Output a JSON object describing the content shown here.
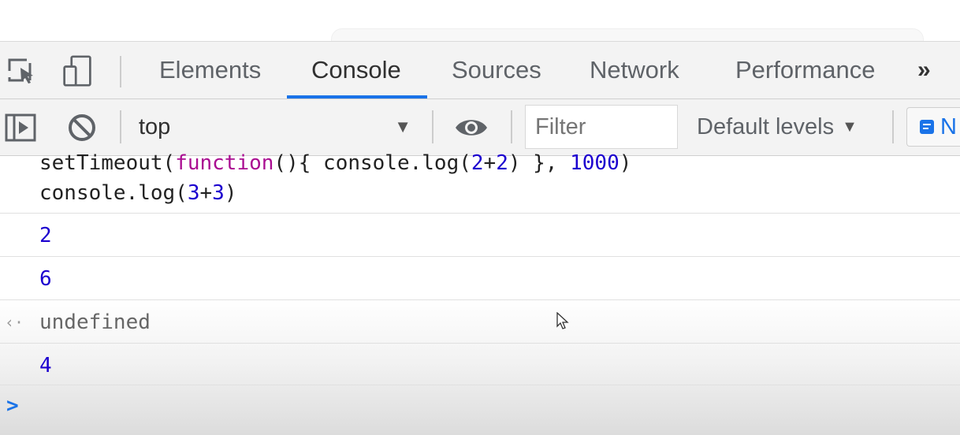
{
  "tabs": {
    "items": [
      {
        "label": "Elements"
      },
      {
        "label": "Console"
      },
      {
        "label": "Sources"
      },
      {
        "label": "Network"
      },
      {
        "label": "Performance"
      }
    ],
    "active": "Console",
    "more": "»"
  },
  "toolbar": {
    "context": "top",
    "filter_placeholder": "Filter",
    "levels": "Default levels",
    "issues_label": "N"
  },
  "console": {
    "input_lines": [
      "setTimeout(function(){ console.log(2+2) }, 1000)",
      "console.log(3+3)"
    ],
    "outputs": [
      {
        "value": "2",
        "kind": "log"
      },
      {
        "value": "6",
        "kind": "log"
      },
      {
        "value": "undefined",
        "kind": "return"
      },
      {
        "value": "4",
        "kind": "log"
      }
    ],
    "prompt": ">"
  },
  "colors": {
    "accent": "#1a73e8",
    "keyword": "#aa0d91",
    "number": "#1c00cf",
    "text": "#222222"
  },
  "icons": {
    "inspect": "inspect-element-icon",
    "device": "device-toolbar-icon",
    "sidebar": "show-sidebar-icon",
    "clear": "clear-console-icon",
    "eye": "live-expression-icon",
    "issues": "issues-icon",
    "return": "return-value-icon",
    "prompt": "prompt-icon"
  }
}
